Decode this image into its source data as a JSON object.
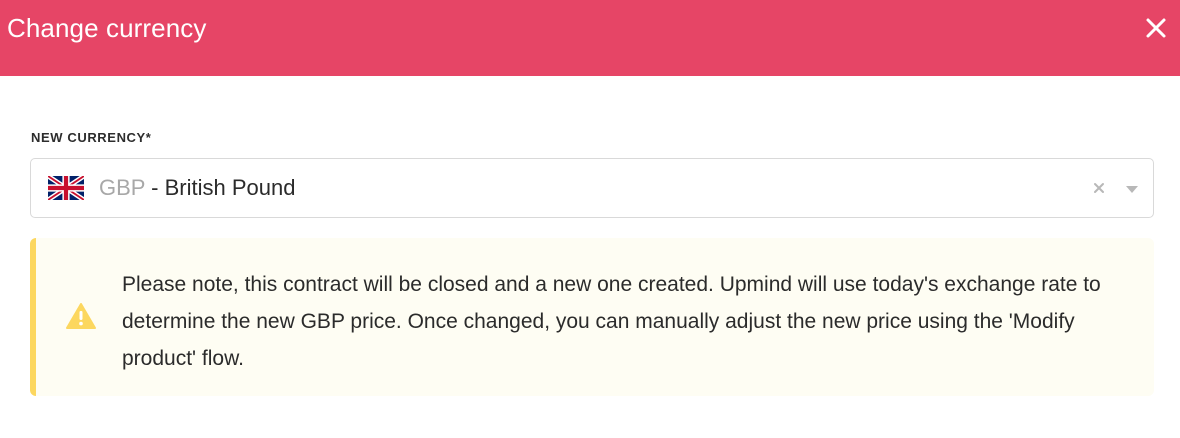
{
  "header": {
    "title": "Change currency",
    "close_icon": "close-icon",
    "background_color": "#e64566"
  },
  "form": {
    "currency_label": "NEW CURRENCY*",
    "currency_select": {
      "flag_icon": "uk-flag-icon",
      "code": "GBP",
      "separator": " - ",
      "name": "British Pound",
      "clear_icon": "clear-icon",
      "dropdown_icon": "chevron-down-icon"
    }
  },
  "notice": {
    "icon": "warning-icon",
    "text": "Please note, this contract will be closed and a new one created. Upmind will use today's exchange rate to determine the new GBP price. Once changed, you can manually adjust the new price using the 'Modify product' flow.",
    "accent_color": "#fcd75f",
    "background_color": "#fefdf3"
  }
}
